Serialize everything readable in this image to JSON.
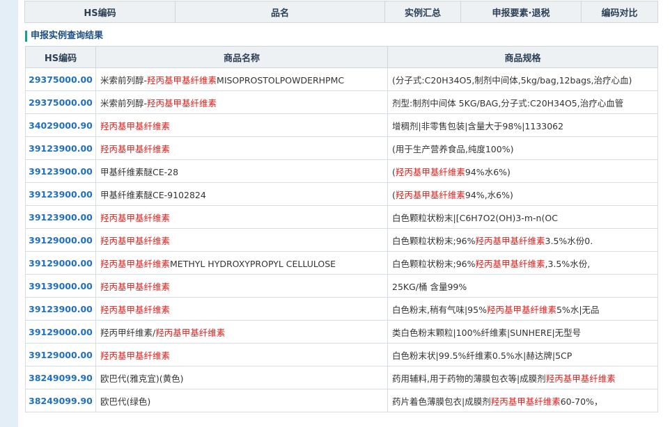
{
  "top_nav": {
    "headers": [
      "HS编码",
      "品名",
      "实例汇总",
      "申报要素·退税",
      "编码对比"
    ]
  },
  "section_title": "申报实例查询结果",
  "table": {
    "headers": [
      "HS编码",
      "商品名称",
      "商品规格"
    ],
    "rows": [
      {
        "code": "29375000.00",
        "name": [
          {
            "t": "米索前列醇-"
          },
          {
            "t": "羟丙基甲基纤维素",
            "hl": true
          },
          {
            "t": "MISOPROSTOLPOWDERHPMC"
          }
        ],
        "spec": [
          {
            "t": "(分子式:C20H34O5,制剂中间体,5kg/bag,12bags,治疗心血)"
          }
        ]
      },
      {
        "code": "29375000.00",
        "name": [
          {
            "t": "米索前列醇-"
          },
          {
            "t": "羟丙基甲基纤维素",
            "hl": true
          }
        ],
        "spec": [
          {
            "t": "剂型:制剂中间体 5KG/BAG,分子式:C20H34O5,治疗心血管"
          }
        ]
      },
      {
        "code": "34029000.90",
        "name": [
          {
            "t": "羟丙基甲基纤维素",
            "hl": true
          }
        ],
        "spec": [
          {
            "t": "增稠剂|非零售包装|含量大于98%|1133062"
          }
        ]
      },
      {
        "code": "39123900.00",
        "name": [
          {
            "t": "羟丙基甲基纤维素",
            "hl": true
          }
        ],
        "spec": [
          {
            "t": "(用于生产营养食品,纯度100%)"
          }
        ]
      },
      {
        "code": "39123900.00",
        "name": [
          {
            "t": "甲基纤维素醚CE-28"
          }
        ],
        "spec": [
          {
            "t": "("
          },
          {
            "t": "羟丙基甲基纤维素",
            "hl": true
          },
          {
            "t": "94%水6%)"
          }
        ]
      },
      {
        "code": "39123900.00",
        "name": [
          {
            "t": "甲基纤维素醚CE-9102824"
          }
        ],
        "spec": [
          {
            "t": "("
          },
          {
            "t": "羟丙基甲基纤维素",
            "hl": true
          },
          {
            "t": "94%,水6%)"
          }
        ]
      },
      {
        "code": "39123900.00",
        "name": [
          {
            "t": "羟丙基甲基纤维素",
            "hl": true
          }
        ],
        "spec": [
          {
            "t": "白色颗粒状粉末|[C6H7O2(OH)3-m-n(OC"
          }
        ]
      },
      {
        "code": "39129000.00",
        "name": [
          {
            "t": "羟丙基甲基纤维素",
            "hl": true
          }
        ],
        "spec": [
          {
            "t": "白色颗粒状粉末;96%"
          },
          {
            "t": "羟丙基甲基纤维素",
            "hl": true
          },
          {
            "t": "3.5%水份0."
          }
        ]
      },
      {
        "code": "39129000.00",
        "name": [
          {
            "t": "羟丙基甲基纤维素",
            "hl": true
          },
          {
            "t": "METHYL HYDROXYPROPYL CELLULOSE"
          }
        ],
        "spec": [
          {
            "t": "白色颗粒状粉末;96%"
          },
          {
            "t": "羟丙基甲基纤维素",
            "hl": true
          },
          {
            "t": ",3.5%水份,"
          }
        ]
      },
      {
        "code": "39139000.00",
        "name": [
          {
            "t": "羟丙基甲基纤维素",
            "hl": true
          }
        ],
        "spec": [
          {
            "t": "25KG/桶 含量99%"
          }
        ]
      },
      {
        "code": "39123900.00",
        "name": [
          {
            "t": "羟丙基甲基纤维素",
            "hl": true
          }
        ],
        "spec": [
          {
            "t": "白色粉末,稍有气味|95%"
          },
          {
            "t": "羟丙基甲基纤维素",
            "hl": true
          },
          {
            "t": "5%水|无品"
          }
        ]
      },
      {
        "code": "39129000.00",
        "name": [
          {
            "t": "羟丙甲纤维素/"
          },
          {
            "t": "羟丙基甲基纤维素",
            "hl": true
          }
        ],
        "spec": [
          {
            "t": "类白色粉末颗粒|100%纤维素|SUNHERE|无型号"
          }
        ]
      },
      {
        "code": "39129000.00",
        "name": [
          {
            "t": "羟丙基甲基纤维素",
            "hl": true
          }
        ],
        "spec": [
          {
            "t": "白色粉末状|99.5%纤维素0.5%水|赫达牌|5CP"
          }
        ]
      },
      {
        "code": "38249099.90",
        "name": [
          {
            "t": "欧巴代(雅克宜)(黄色)"
          }
        ],
        "spec": [
          {
            "t": "药用辅料,用于药物的薄膜包衣等|成膜剂"
          },
          {
            "t": "羟丙基甲基纤维素",
            "hl": true
          }
        ]
      },
      {
        "code": "38249099.90",
        "name": [
          {
            "t": "欧巴代(绿色)"
          }
        ],
        "spec": [
          {
            "t": "药片着色薄膜包衣|成膜剂"
          },
          {
            "t": "羟丙基甲基纤维素",
            "hl": true
          },
          {
            "t": "60-70%，"
          }
        ]
      }
    ]
  },
  "colors": {
    "page_bg": "#e4eef6",
    "header_bg": "#eef1f3",
    "code_blue": "#1f6fc4",
    "highlight_red": "#e0201c",
    "section_bar": "#1a9c8e"
  }
}
